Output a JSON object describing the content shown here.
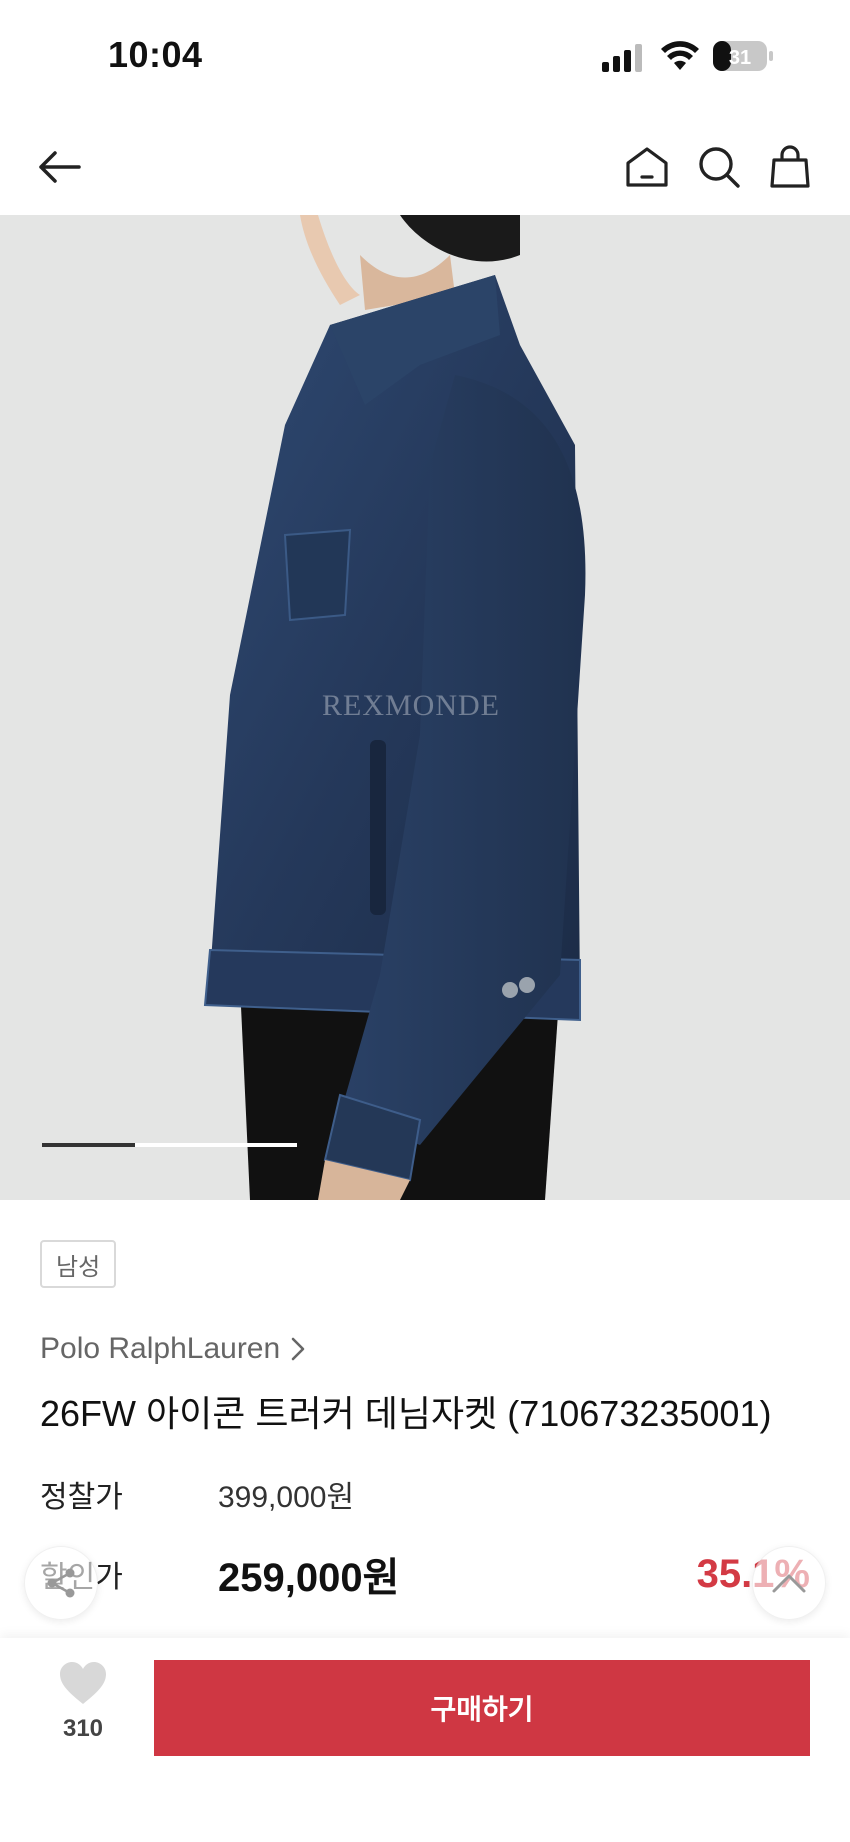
{
  "status": {
    "time": "10:04",
    "battery": "31"
  },
  "product": {
    "image_watermark": "REXMONDE",
    "tag": "남성",
    "brand": "Polo RalphLauren",
    "title": "26FW 아이콘 트러커 데님자켓 (710673235001)",
    "original_label": "정찰가",
    "original_price": "399,000원",
    "sale_label": "할인가",
    "sale_price": "259,000원",
    "discount_rate": "35.1%",
    "image_count": 2,
    "image_current": 1
  },
  "bottom": {
    "like_count": "310",
    "buy_label": "구매하기"
  },
  "colors": {
    "accent": "#cf3743",
    "discount": "#d33a44"
  },
  "icons": [
    "back-arrow-icon",
    "home-icon",
    "search-icon",
    "shopping-bag-icon",
    "share-icon",
    "chevron-up-icon",
    "heart-icon"
  ]
}
